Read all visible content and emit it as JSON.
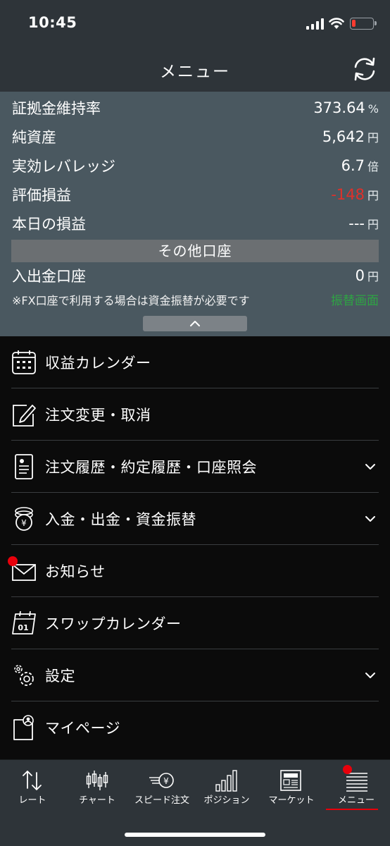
{
  "status": {
    "time": "10:45"
  },
  "header": {
    "title": "メニュー"
  },
  "account": {
    "rows": [
      {
        "label": "証拠金維持率",
        "value": "373.64",
        "unit": "%"
      },
      {
        "label": "純資産",
        "value": "5,642",
        "unit": "円"
      },
      {
        "label": "実効レバレッジ",
        "value": "6.7",
        "unit": "倍"
      },
      {
        "label": "評価損益",
        "value": "-148",
        "unit": "円"
      },
      {
        "label": "本日の損益",
        "value": "---",
        "unit": "円"
      }
    ],
    "other_header": "その他口座",
    "deposit_row": {
      "label": "入出金口座",
      "value": "0",
      "unit": "円"
    },
    "note": "※FX口座で利用する場合は資金振替が必要です",
    "transfer_link": "振替画面",
    "colors": {
      "negative": "#e0302a",
      "link": "#2ea443"
    }
  },
  "menu": {
    "items": [
      {
        "label": "収益カレンダー",
        "icon": "calendar-icon"
      },
      {
        "label": "注文変更・取消",
        "icon": "edit-icon"
      },
      {
        "label": "注文履歴・約定履歴・口座照会",
        "icon": "document-icon"
      },
      {
        "label": "入金・出金・資金振替",
        "icon": "coins-yen-icon"
      },
      {
        "label": "お知らせ",
        "icon": "mail-icon"
      },
      {
        "label": "スワップカレンダー",
        "icon": "swap-calendar-icon"
      },
      {
        "label": "設定",
        "icon": "gear-icon"
      },
      {
        "label": "マイページ",
        "icon": "mypage-icon"
      }
    ]
  },
  "tabs": [
    {
      "label": "レート",
      "icon": "rate-arrows-icon"
    },
    {
      "label": "チャート",
      "icon": "candlestick-icon"
    },
    {
      "label": "スピード注文",
      "icon": "speed-order-icon"
    },
    {
      "label": "ポジション",
      "icon": "position-bars-icon"
    },
    {
      "label": "マーケット",
      "icon": "market-news-icon"
    },
    {
      "label": "メニュー",
      "icon": "menu-list-icon"
    }
  ],
  "theme": {
    "accent": "#e8000b",
    "bar": "#2e3439",
    "panel": "#4a5860"
  }
}
